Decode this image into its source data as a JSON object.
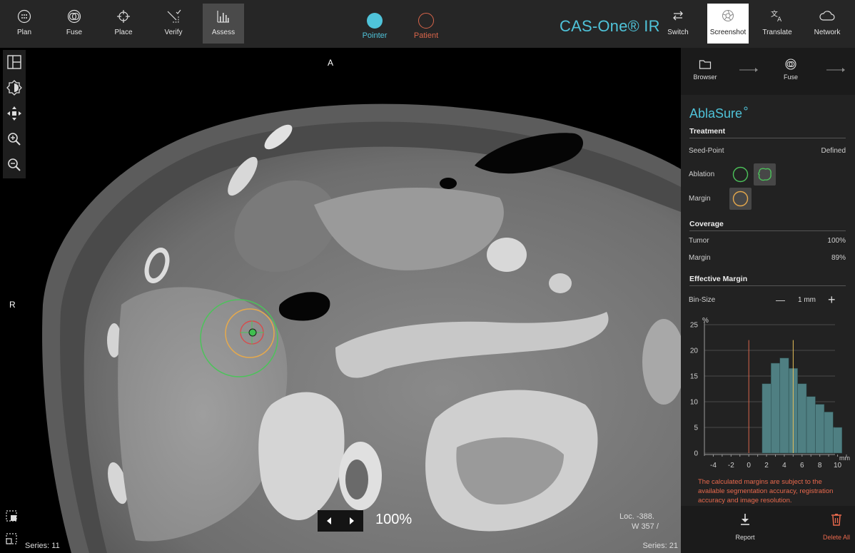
{
  "toolbar": {
    "left_items": [
      {
        "label": "Plan",
        "icon": "plan-icon"
      },
      {
        "label": "Fuse",
        "icon": "fuse-icon"
      },
      {
        "label": "Place",
        "icon": "place-crosshair-icon"
      },
      {
        "label": "Verify",
        "icon": "verify-icon"
      },
      {
        "label": "Assess",
        "icon": "assess-chart-icon",
        "active": true
      }
    ],
    "pointer_label": "Pointer",
    "patient_label": "Patient",
    "brand": "CAS-One® IR",
    "right_items": [
      {
        "label": "Switch",
        "icon": "switch-arrows-icon"
      },
      {
        "label": "Screenshot",
        "icon": "camera-shutter-icon",
        "active": true
      },
      {
        "label": "Translate",
        "icon": "translate-icon"
      },
      {
        "label": "Network",
        "icon": "cloud-icon"
      }
    ],
    "colors": {
      "accent": "#4fc3d9",
      "patient": "#d9654a"
    }
  },
  "left_tools": [
    "layout-icon",
    "contrast-icon",
    "pan-move-icon",
    "zoom-in-icon",
    "zoom-out-icon"
  ],
  "left_bottom_tools": [
    "select-region-icon",
    "select-dashed-icon"
  ],
  "viewer": {
    "orient_top": "A",
    "orient_left": "R",
    "series_left": "Series: 11",
    "series_right": "Series: 21",
    "loc_line1": "Loc. -388.",
    "loc_line2": "W 357 /",
    "zoom": "100%"
  },
  "panel": {
    "nav": [
      {
        "label": "Browser",
        "icon": "folder-icon"
      },
      {
        "label": "Fuse",
        "icon": "fuse-icon"
      }
    ],
    "title": "AblaSure",
    "treatment": {
      "header": "Treatment",
      "seed_label": "Seed-Point",
      "seed_value": "Defined",
      "ablation_label": "Ablation",
      "margin_label": "Margin"
    },
    "coverage": {
      "header": "Coverage",
      "tumor_label": "Tumor",
      "tumor_value": "100%",
      "margin_label": "Margin",
      "margin_value": "89%"
    },
    "effective_margin": {
      "header": "Effective Margin",
      "bin_label": "Bin-Size",
      "bin_value": "1 mm",
      "minus": "—",
      "plus": "+"
    },
    "warning": "The calculated margins are subject to the available segmentation accuracy, registration accuracy and image resolution.",
    "actions": [
      {
        "label": "Report",
        "icon": "download-icon"
      },
      {
        "label": "Delete All",
        "icon": "trash-icon"
      }
    ]
  },
  "chart_data": {
    "type": "bar",
    "ylabel": "%",
    "xlabel": "mm",
    "ylim": [
      0,
      25
    ],
    "xlim": [
      -5,
      11
    ],
    "yticks": [
      0,
      5,
      10,
      15,
      20,
      25
    ],
    "xticks": [
      -4,
      -2,
      0,
      2,
      4,
      6,
      8,
      10
    ],
    "bin_size": 1,
    "bins": [
      {
        "x": 2,
        "value": 13.5
      },
      {
        "x": 3,
        "value": 17.5
      },
      {
        "x": 4,
        "value": 18.5
      },
      {
        "x": 5,
        "value": 16.5
      },
      {
        "x": 6,
        "value": 13.5
      },
      {
        "x": 7,
        "value": 11
      },
      {
        "x": 8,
        "value": 9.5
      },
      {
        "x": 9,
        "value": 8
      },
      {
        "x": 10,
        "value": 5
      }
    ],
    "reference_lines": [
      {
        "x": 0,
        "color": "#d9654a"
      },
      {
        "x": 5,
        "color": "#e8c05a"
      }
    ],
    "bar_color": "#4f7f82",
    "grid": true
  }
}
